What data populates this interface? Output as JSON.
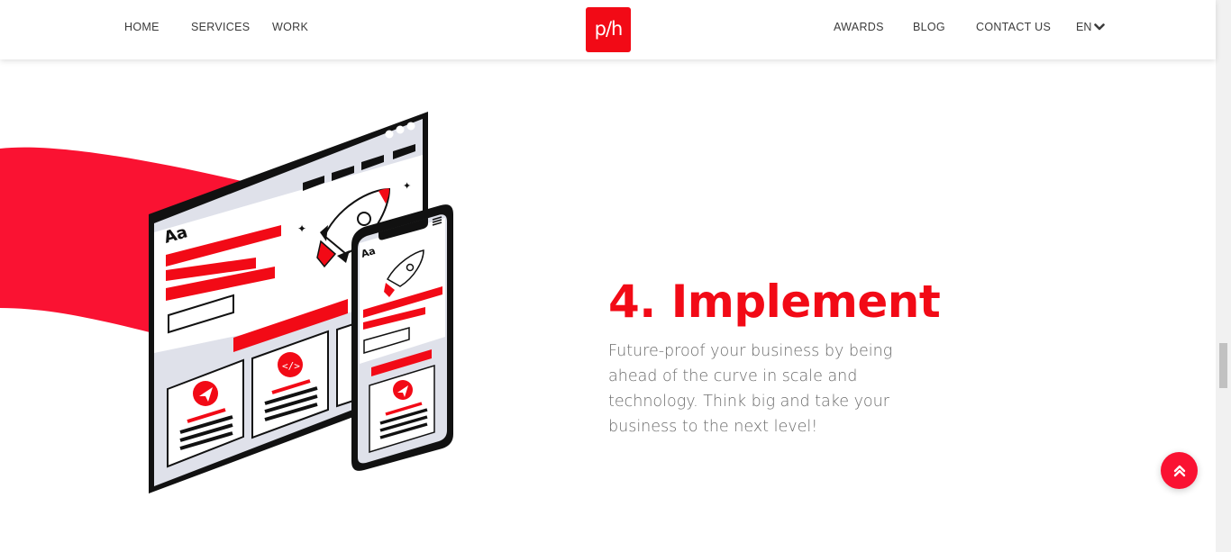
{
  "header": {
    "nav_left": [
      "HOME",
      "SERVICES",
      "WORK"
    ],
    "nav_right": [
      "AWARDS",
      "BLOG",
      "CONTACT US"
    ],
    "logo_text": "p/h",
    "language": "EN"
  },
  "illustration": {
    "desktop_label": "Aa",
    "phone_label": "Aa"
  },
  "section": {
    "title": "4. Implement",
    "description": "Future-proof your business by being ahead of the curve in scale and technology. Think big and take your business to the next level!"
  },
  "colors": {
    "brand_red": "#f20a16",
    "wave_red": "#fa1232",
    "text_gray": "#6b6b6b",
    "nav_text": "#3b3b3b"
  },
  "icons": [
    "chevron-down-icon",
    "double-chevron-up-icon",
    "paper-plane-icon",
    "code-icon",
    "rocket-icon"
  ]
}
